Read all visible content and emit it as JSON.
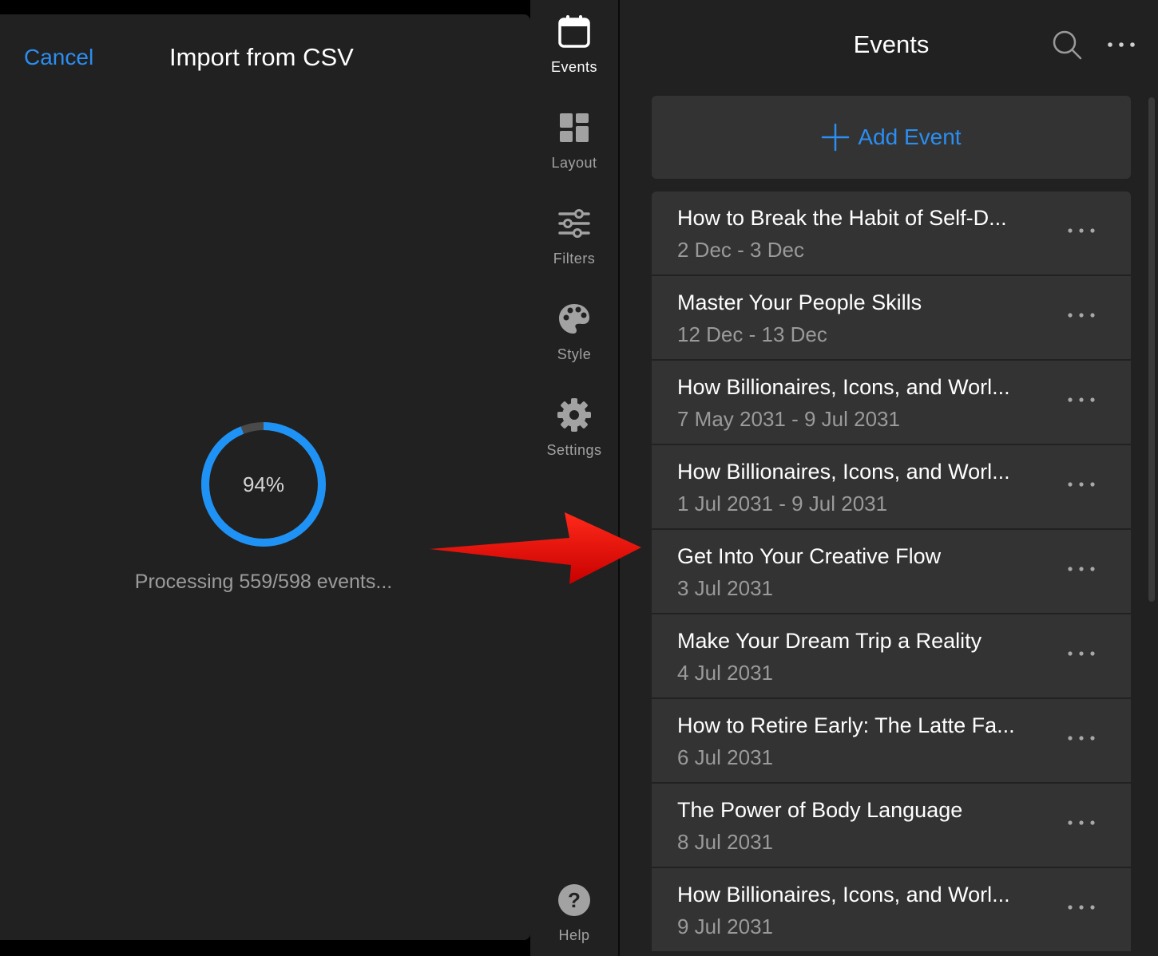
{
  "modal": {
    "cancel_label": "Cancel",
    "title": "Import from CSV",
    "progress_percent_label": "94%",
    "progress_fraction": 0.94,
    "status_text": "Processing 559/598 events..."
  },
  "sidebar": {
    "items": [
      {
        "label": "Events",
        "icon": "calendar-icon",
        "active": true
      },
      {
        "label": "Layout",
        "icon": "layout-grid-icon",
        "active": false
      },
      {
        "label": "Filters",
        "icon": "sliders-icon",
        "active": false
      },
      {
        "label": "Style",
        "icon": "palette-icon",
        "active": false
      },
      {
        "label": "Settings",
        "icon": "gear-icon",
        "active": false
      },
      {
        "label": "Help",
        "icon": "help-icon",
        "active": false
      }
    ]
  },
  "main": {
    "title": "Events",
    "add_event_label": "Add Event",
    "events": [
      {
        "title": "How to Break the Habit of Self-D...",
        "date": "2 Dec - 3 Dec"
      },
      {
        "title": "Master Your People Skills",
        "date": "12 Dec - 13 Dec"
      },
      {
        "title": "How Billionaires, Icons, and Worl...",
        "date": "7 May 2031 - 9 Jul 2031"
      },
      {
        "title": "How Billionaires, Icons, and Worl...",
        "date": "1 Jul 2031 - 9 Jul 2031"
      },
      {
        "title": "Get Into Your Creative Flow",
        "date": "3 Jul 2031"
      },
      {
        "title": "Make Your Dream Trip a Reality",
        "date": "4 Jul 2031"
      },
      {
        "title": "How to Retire Early: The Latte Fa...",
        "date": "6 Jul 2031"
      },
      {
        "title": "The Power of Body Language",
        "date": "8 Jul 2031"
      },
      {
        "title": "How Billionaires, Icons, and Worl...",
        "date": "9 Jul 2031"
      }
    ]
  },
  "colors": {
    "accent": "#2b8ef0",
    "progress_track": "#4a4a4a",
    "annotation_arrow": "#e00000"
  }
}
